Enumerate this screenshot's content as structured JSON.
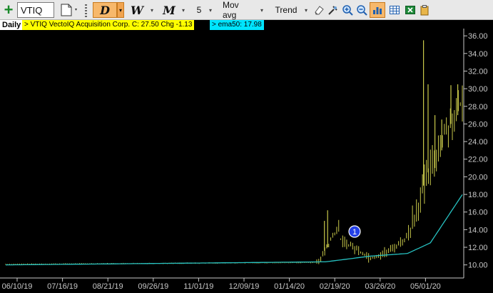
{
  "toolbar": {
    "symbol": "VTIQ",
    "period_daily": "D",
    "period_weekly": "W",
    "period_monthly": "M",
    "count": "5",
    "indicator": "Mov avg",
    "trend": "Trend",
    "dropdown_glyph": "▾"
  },
  "legend": {
    "period": "Daily",
    "quote": "> VTIQ  VectoIQ Acquisition Corp.  C: 27.50  Chg -1.13",
    "ema": "> ema50: 17.98"
  },
  "colors": {
    "price_bars": "#c8c84a",
    "ema_line": "#27c2c2",
    "axis": "#c8c8c8",
    "quote_bg": "#ffff00",
    "ema_bg": "#00e5ff"
  },
  "chart_data": {
    "type": "ohlc",
    "series_label": "VTIQ",
    "x_ticks": [
      "06/10/19",
      "07/16/19",
      "08/21/19",
      "09/26/19",
      "11/01/19",
      "12/09/19",
      "01/14/20",
      "02/19/20",
      "03/26/20",
      "05/01/20"
    ],
    "y_ticks": [
      "10.00",
      "12.00",
      "14.00",
      "16.00",
      "18.00",
      "20.00",
      "22.00",
      "24.00",
      "26.00",
      "28.00",
      "30.00",
      "32.00",
      "34.00",
      "36.00"
    ],
    "ylim": [
      9,
      36.5
    ],
    "marker": "1",
    "price_segments": [
      {
        "from": 0,
        "to": 0.685,
        "start": 10.1,
        "end": 10.3
      },
      {
        "from": 0.685,
        "to": 0.73,
        "start": 10.3,
        "end": 14.5
      },
      {
        "from": 0.73,
        "to": 0.8,
        "start": 13.0,
        "end": 10.8
      },
      {
        "from": 0.8,
        "to": 0.84,
        "start": 10.8,
        "end": 11.6
      },
      {
        "from": 0.84,
        "to": 0.88,
        "start": 11.6,
        "end": 13.2
      },
      {
        "from": 0.88,
        "to": 0.91,
        "start": 13.2,
        "end": 18.0
      },
      {
        "from": 0.91,
        "to": 0.96,
        "start": 18.0,
        "end": 25.0
      },
      {
        "from": 0.96,
        "to": 1.0,
        "start": 25.0,
        "end": 28.5
      }
    ],
    "spikes": [
      {
        "at": 0.705,
        "high": 16.2,
        "low": 12.0
      },
      {
        "at": 0.698,
        "high": 15.0,
        "low": 11.6
      },
      {
        "at": 0.915,
        "high": 35.5,
        "low": 19.0
      },
      {
        "at": 0.925,
        "high": 30.5,
        "low": 20.5
      },
      {
        "at": 0.94,
        "high": 27.0,
        "low": 21.0
      },
      {
        "at": 0.955,
        "high": 26.5,
        "low": 23.0
      },
      {
        "at": 0.975,
        "high": 30.4,
        "low": 26.0
      },
      {
        "at": 0.99,
        "high": 30.5,
        "low": 27.0
      }
    ],
    "ema_segments": [
      {
        "from": 0,
        "to": 0.7,
        "start": 10.0,
        "end": 10.35
      },
      {
        "from": 0.7,
        "to": 0.8,
        "start": 10.35,
        "end": 11.0
      },
      {
        "from": 0.8,
        "to": 0.88,
        "start": 11.0,
        "end": 11.3
      },
      {
        "from": 0.88,
        "to": 0.93,
        "start": 11.3,
        "end": 12.5
      },
      {
        "from": 0.93,
        "to": 1.0,
        "start": 12.5,
        "end": 17.98
      }
    ]
  }
}
